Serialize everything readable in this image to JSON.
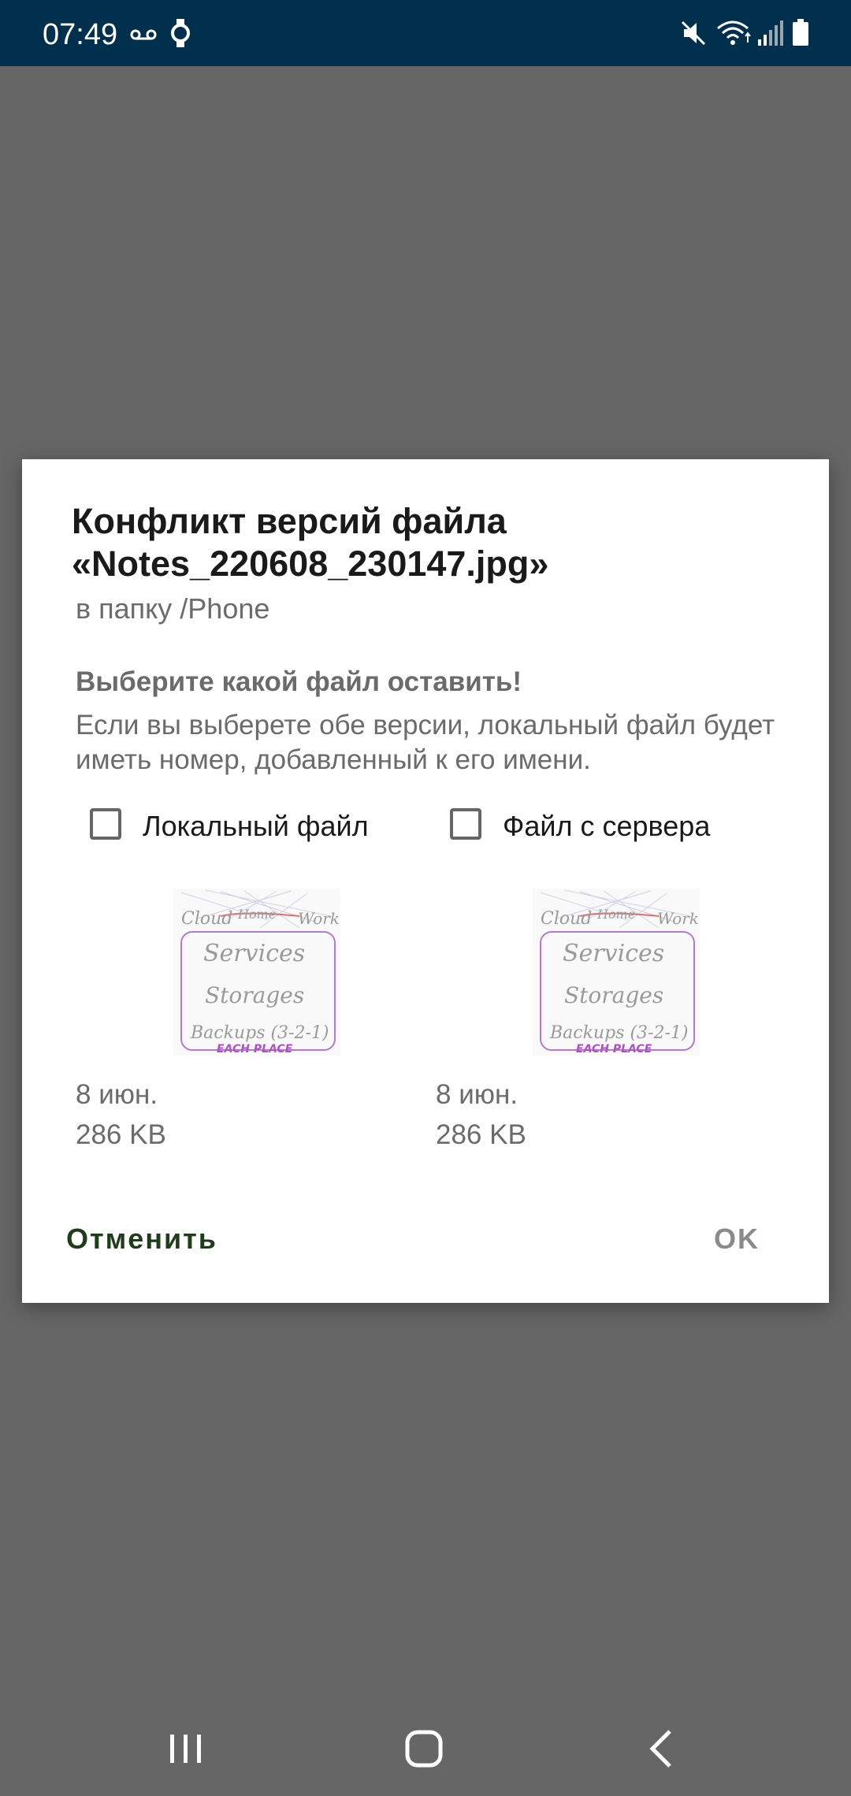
{
  "status_bar": {
    "time": "07:49",
    "icons": [
      "voicemail-icon",
      "watch-icon",
      "mute-icon",
      "wifi-icon",
      "signal-icon",
      "battery-icon"
    ]
  },
  "dialog": {
    "title": "Конфликт версий файла «Notes_220608_230147.jpg»",
    "subtitle": "в папку /Phone",
    "prompt": "Выберите какой файл оставить!",
    "info": "Если вы выберете обе версии, локальный файл будет иметь номер, добавленный к его имени.",
    "local": {
      "label": "Локальный файл",
      "checked": false,
      "date": "8 июн.",
      "size": "286 KB"
    },
    "server": {
      "label": "Файл с сервера",
      "checked": false,
      "date": "8 июн.",
      "size": "286 KB"
    },
    "cancel_label": "Отменить",
    "ok_label": "OK"
  },
  "thumbnail": {
    "top_words": [
      "Cloud",
      "Home",
      "Work"
    ],
    "line2": "Services",
    "line3": "Storages",
    "line4": "Backups (3-2-1)",
    "line5": "EACH PLACE"
  },
  "nav_bar": {
    "buttons": [
      "recents-icon",
      "home-icon",
      "back-icon"
    ]
  },
  "colors": {
    "status_bar_bg": "#01304e",
    "scrim": "#666666",
    "cancel_text": "#1f3d1a",
    "ok_text_disabled": "#8a8a8a"
  }
}
